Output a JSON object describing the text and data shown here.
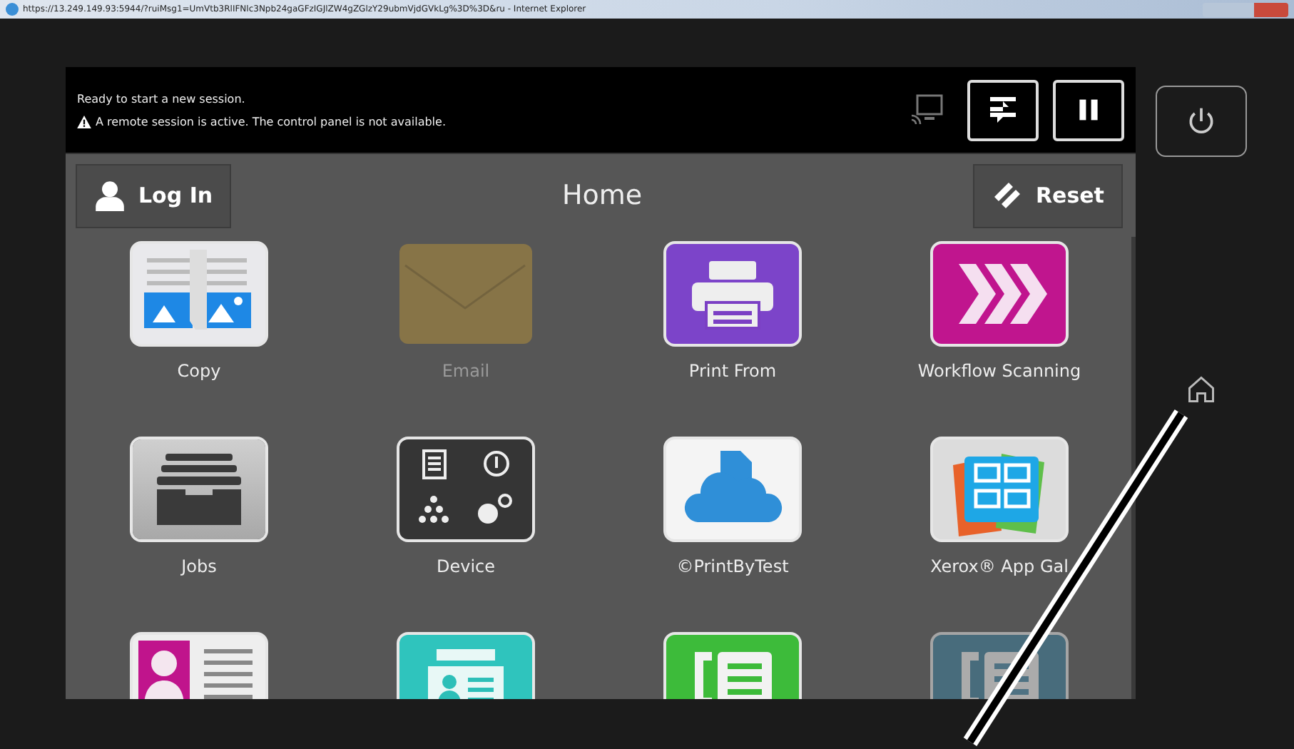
{
  "window": {
    "title": "https://13.249.149.93:5944/?ruiMsg1=UmVtb3RlIFNlc3Npb24gaGFzIGJlZW4gZGlzY29ubmVjdGVkLg%3D%3D&ru - Internet Explorer"
  },
  "status": {
    "message": "Ready to start a new session.",
    "warning": "A remote session is active. The control panel is not available."
  },
  "header": {
    "login": "Log In",
    "title": "Home",
    "reset": "Reset"
  },
  "apps": [
    {
      "label": "Copy",
      "disabled": false
    },
    {
      "label": "Email",
      "disabled": true
    },
    {
      "label": "Print From",
      "disabled": false
    },
    {
      "label": "Workflow Scanning",
      "disabled": false
    },
    {
      "label": "Jobs",
      "disabled": false
    },
    {
      "label": "Device",
      "disabled": false
    },
    {
      "label": "©PrintByTest",
      "disabled": false
    },
    {
      "label": "Xerox® App Gal",
      "disabled": false
    },
    {
      "disabled": false
    },
    {
      "disabled": false
    },
    {
      "disabled": false
    },
    {
      "disabled": true
    }
  ]
}
